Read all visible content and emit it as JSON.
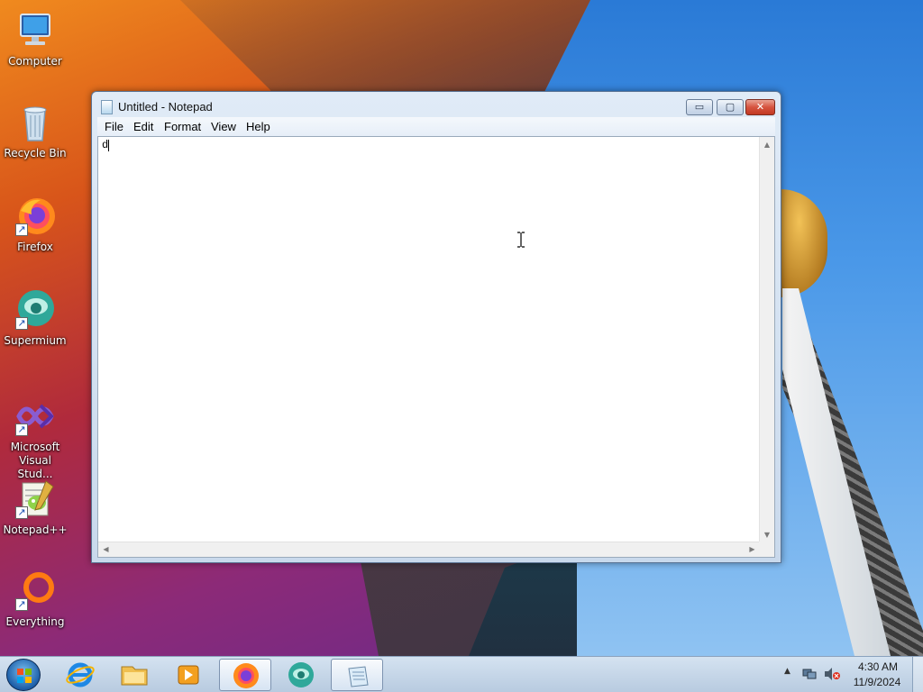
{
  "desktop": {
    "icons": [
      {
        "label": "Computer"
      },
      {
        "label": "Recycle Bin"
      },
      {
        "label": "Firefox"
      },
      {
        "label": "Supermium"
      },
      {
        "label": "Microsoft Visual Stud..."
      },
      {
        "label": "Notepad++"
      },
      {
        "label": "Everything"
      }
    ]
  },
  "window": {
    "title": "Untitled - Notepad",
    "controls": {
      "minimize": "▭",
      "maximize": "▢",
      "close": "✕"
    },
    "menu": [
      "File",
      "Edit",
      "Format",
      "View",
      "Help"
    ],
    "editor": {
      "text": "d"
    },
    "scroll": {
      "up": "▲",
      "down": "▼",
      "left": "◀",
      "right": "▶"
    }
  },
  "taskbar": {
    "pinned": [
      {
        "icon": "internet-explorer-icon"
      },
      {
        "icon": "file-explorer-icon"
      },
      {
        "icon": "media-player-icon"
      },
      {
        "icon": "firefox-icon"
      },
      {
        "icon": "supermium-icon"
      },
      {
        "icon": "notepad-icon"
      }
    ],
    "tray": {
      "expand": "▲"
    },
    "clock": {
      "time": "4:30 AM",
      "date": "11/9/2024"
    }
  },
  "colors": {
    "taskbar": "#c4d6ea",
    "close_button": "#c94a34",
    "window_frame": "#cfdded"
  }
}
